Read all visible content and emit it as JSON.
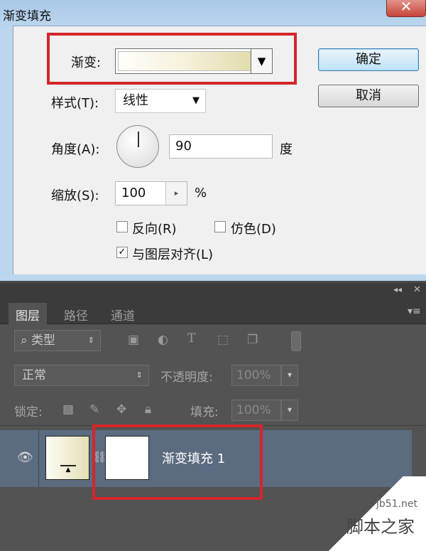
{
  "dialog": {
    "title": "渐变填充",
    "close_glyph": "✕",
    "gradient_label": "渐变:",
    "style_label": "样式(T):",
    "style_value": "线性",
    "angle_label": "角度(A):",
    "angle_value": "90",
    "angle_unit": "度",
    "scale_label": "缩放(S):",
    "scale_value": "100",
    "scale_unit": "%",
    "reverse_label": "反向(R)",
    "dither_label": "仿色(D)",
    "align_label": "与图层对齐(L)",
    "ok_label": "确定",
    "cancel_label": "取消",
    "reverse_checked": false,
    "dither_checked": false,
    "align_checked": true
  },
  "layers_panel": {
    "collapse_glyph": "◂◂",
    "close_glyph": "✕",
    "tabs": [
      "图层",
      "路径",
      "通道"
    ],
    "filter_kind": "类型",
    "blend_mode": "正常",
    "opacity_label": "不透明度:",
    "opacity_value": "100%",
    "lock_label": "锁定:",
    "fill_label": "填充:",
    "fill_value": "100%",
    "layer_name": "渐变填充 1"
  },
  "watermark": {
    "site": "jb51.net",
    "brand": "脚本之家"
  },
  "colors": {
    "highlight": "#d3262c",
    "layer_selected": "#5b6b80"
  }
}
